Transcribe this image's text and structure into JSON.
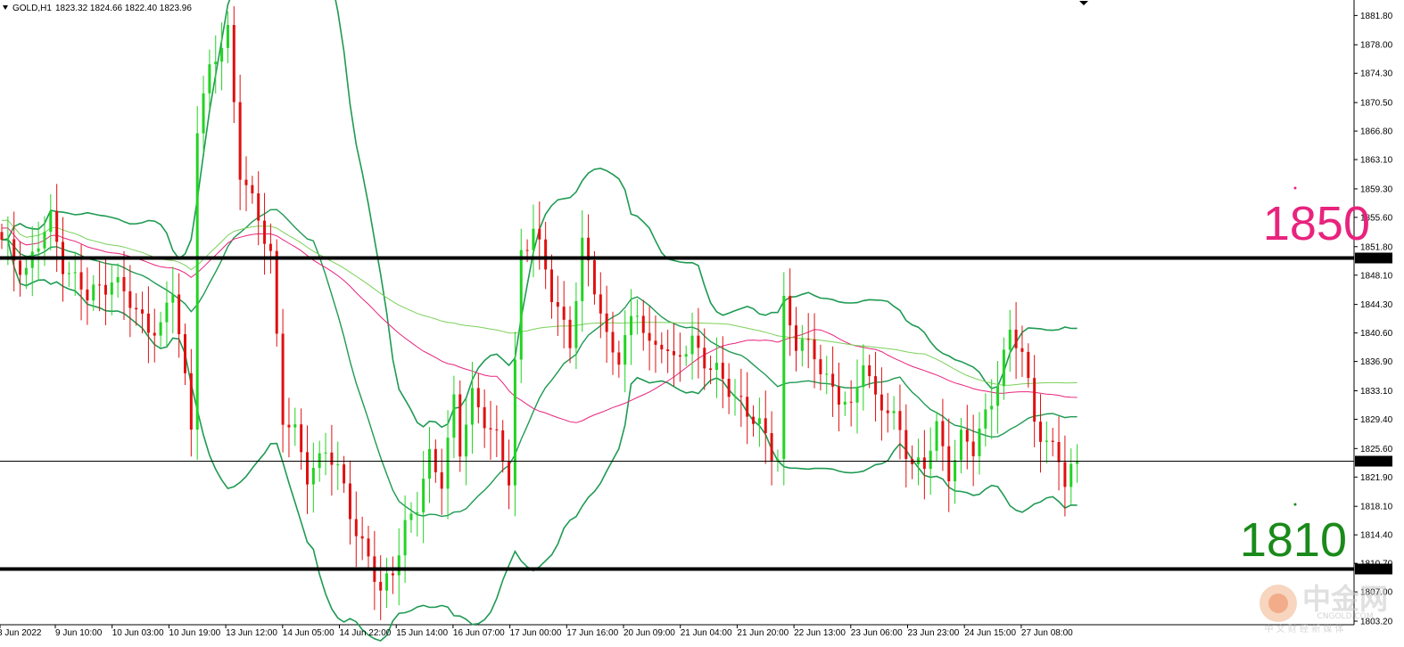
{
  "header": {
    "symbol_timeframe": "GOLD,H1",
    "ohlc": "1823.32 1824.66 1822.40 1823.96"
  },
  "annotations": {
    "upper_level_label": "1850",
    "lower_level_label": "1810",
    "upper_level_color": "#e8237d",
    "lower_level_color": "#1a8a1a"
  },
  "watermark": {
    "brand": "中金网",
    "site": "CNGOLD.COM",
    "tagline": "中 文 财 经 新 媒 体"
  },
  "chart_data": {
    "type": "candlestick",
    "symbol": "GOLD",
    "timeframe": "H1",
    "ylim": [
      1803.2,
      1883.0
    ],
    "y_ticks": [
      "1881.80",
      "1878.00",
      "1874.30",
      "1870.50",
      "1866.80",
      "1863.10",
      "1859.30",
      "1855.60",
      "1851.80",
      "1848.10",
      "1844.30",
      "1840.60",
      "1836.90",
      "1833.10",
      "1829.40",
      "1825.60",
      "1821.90",
      "1818.10",
      "1814.40",
      "1810.70",
      "1807.00",
      "1803.20"
    ],
    "x_ticks": [
      "8 Jun 2022",
      "9 Jun 10:00",
      "10 Jun 03:00",
      "10 Jun 19:00",
      "13 Jun 12:00",
      "14 Jun 05:00",
      "14 Jun 22:00",
      "15 Jun 14:00",
      "16 Jun 07:00",
      "17 Jun 00:00",
      "17 Jun 16:00",
      "20 Jun 09:00",
      "21 Jun 04:00",
      "21 Jun 20:00",
      "22 Jun 13:00",
      "23 Jun 06:00",
      "23 Jun 23:00",
      "24 Jun 15:00",
      "27 Jun 08:00"
    ],
    "horizontal_lines": [
      {
        "label": "1850.37",
        "value": 1850.37,
        "style": "thick"
      },
      {
        "label": "1823.96",
        "value": 1823.96,
        "style": "thin"
      },
      {
        "label": "1810.01",
        "value": 1810.01,
        "style": "thick"
      }
    ],
    "key_levels": [
      1850,
      1810
    ],
    "price_path": [
      [
        0,
        1852
      ],
      [
        4,
        1849
      ],
      [
        8,
        1855
      ],
      [
        10,
        1850
      ],
      [
        14,
        1845
      ],
      [
        18,
        1848
      ],
      [
        22,
        1843
      ],
      [
        26,
        1841
      ],
      [
        28,
        1846
      ],
      [
        31,
        1829
      ],
      [
        32,
        1868
      ],
      [
        34,
        1874
      ],
      [
        37,
        1880
      ],
      [
        39,
        1862
      ],
      [
        41,
        1857
      ],
      [
        44,
        1851
      ],
      [
        46,
        1830
      ],
      [
        48,
        1827
      ],
      [
        50,
        1822
      ],
      [
        53,
        1826
      ],
      [
        56,
        1820
      ],
      [
        58,
        1815
      ],
      [
        60,
        1812
      ],
      [
        62,
        1806
      ],
      [
        64,
        1810
      ],
      [
        66,
        1816
      ],
      [
        68,
        1818
      ],
      [
        70,
        1824
      ],
      [
        72,
        1822
      ],
      [
        74,
        1832
      ],
      [
        75,
        1825
      ],
      [
        77,
        1832
      ],
      [
        79,
        1830
      ],
      [
        81,
        1827
      ],
      [
        83,
        1821
      ],
      [
        85,
        1851
      ],
      [
        87,
        1855
      ],
      [
        90,
        1845
      ],
      [
        93,
        1840
      ],
      [
        95,
        1852
      ],
      [
        97,
        1846
      ],
      [
        99,
        1840
      ],
      [
        101,
        1838
      ],
      [
        104,
        1843
      ],
      [
        106,
        1839
      ],
      [
        108,
        1840
      ],
      [
        110,
        1836
      ],
      [
        113,
        1840
      ],
      [
        116,
        1836
      ],
      [
        118,
        1834
      ],
      [
        121,
        1832
      ],
      [
        124,
        1828
      ],
      [
        126,
        1825
      ],
      [
        127,
        1825
      ],
      [
        128,
        1845
      ],
      [
        130,
        1839
      ],
      [
        133,
        1838
      ],
      [
        135,
        1835
      ],
      [
        137,
        1832
      ],
      [
        139,
        1830
      ],
      [
        141,
        1838
      ],
      [
        143,
        1832
      ],
      [
        145,
        1830
      ],
      [
        147,
        1828
      ],
      [
        149,
        1824
      ],
      [
        151,
        1823
      ],
      [
        153,
        1828
      ],
      [
        155,
        1823
      ],
      [
        157,
        1827
      ],
      [
        159,
        1825
      ],
      [
        161,
        1830
      ],
      [
        163,
        1835
      ],
      [
        165,
        1840
      ],
      [
        167,
        1838
      ],
      [
        169,
        1830
      ],
      [
        171,
        1826
      ],
      [
        173,
        1824
      ],
      [
        174,
        1821
      ],
      [
        175,
        1823
      ],
      [
        176,
        1824
      ]
    ],
    "indicators": [
      {
        "name": "Bollinger Bands",
        "color": "#1e9a52"
      },
      {
        "name": "Moving Average",
        "color": "#e8237d"
      },
      {
        "name": "Moving Average",
        "color": "#7ad15a"
      }
    ],
    "grid": false
  }
}
